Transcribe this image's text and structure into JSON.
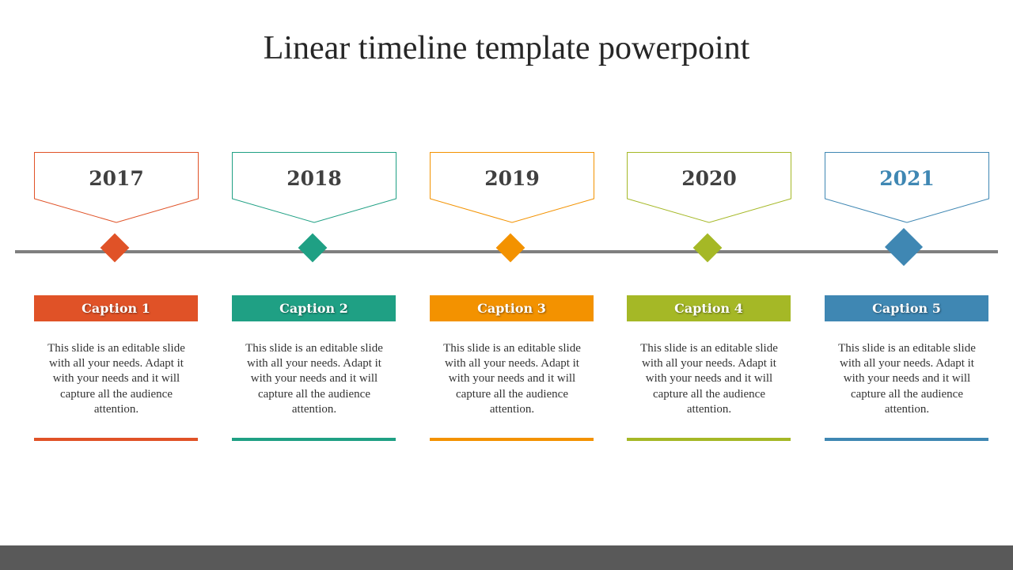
{
  "slide": {
    "title": "Linear timeline template powerpoint"
  },
  "items": [
    {
      "year": "2017",
      "caption": "Caption 1",
      "description": "This slide is an editable slide with all your needs. Adapt it with your needs and it will capture all the audience attention.",
      "color": "#e05227",
      "year_color": "#404040"
    },
    {
      "year": "2018",
      "caption": "Caption 2",
      "description": "This slide is an editable slide with all your needs. Adapt it with your needs and it will capture all the audience attention.",
      "color": "#1fa084",
      "year_color": "#404040"
    },
    {
      "year": "2019",
      "caption": "Caption 3",
      "description": "This slide is an editable slide with all your needs. Adapt it with your needs and it will capture all the audience attention.",
      "color": "#f39200",
      "year_color": "#404040"
    },
    {
      "year": "2020",
      "caption": "Caption 4",
      "description": "This slide is an editable slide with all your needs. Adapt it with your needs and it will capture all the audience attention.",
      "color": "#a5b826",
      "year_color": "#404040"
    },
    {
      "year": "2021",
      "caption": "Caption 5",
      "description": "This slide is an editable slide with all your needs. Adapt it with your needs and it will capture all the audience attention.",
      "color": "#3f87b3",
      "year_color": "#3f87b3",
      "highlighted": true
    }
  ],
  "colors": {
    "timeline_line": "#7f7f7f",
    "footer": "#595959",
    "title": "#262626"
  }
}
